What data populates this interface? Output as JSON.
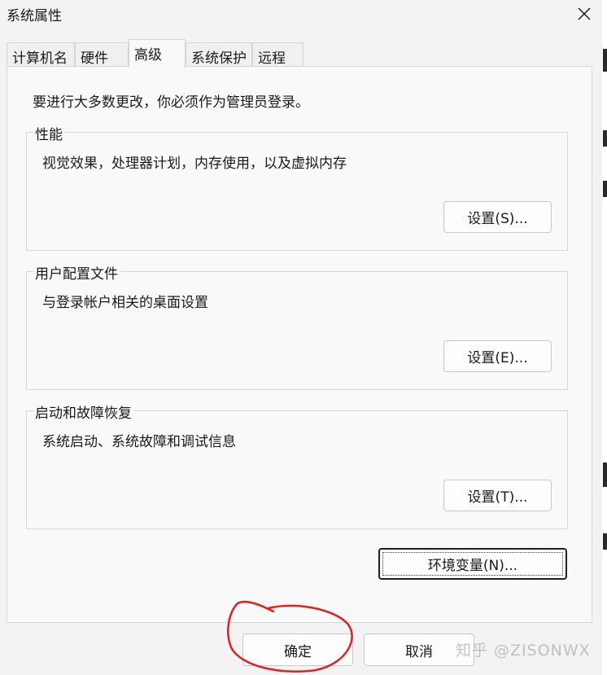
{
  "window": {
    "title": "系统属性"
  },
  "tabs": [
    {
      "label": "计算机名",
      "active": false
    },
    {
      "label": "硬件",
      "active": false
    },
    {
      "label": "高级",
      "active": true
    },
    {
      "label": "系统保护",
      "active": false
    },
    {
      "label": "远程",
      "active": false
    }
  ],
  "advanced": {
    "notice": "要进行大多数更改，你必须作为管理员登录。",
    "performance": {
      "title": "性能",
      "description": "视觉效果，处理器计划，内存使用，以及虚拟内存",
      "button": "设置(S)..."
    },
    "user_profiles": {
      "title": "用户配置文件",
      "description": "与登录帐户相关的桌面设置",
      "button": "设置(E)..."
    },
    "startup_recovery": {
      "title": "启动和故障恢复",
      "description": "系统启动、系统故障和调试信息",
      "button": "设置(T)..."
    },
    "env_button": "环境变量(N)..."
  },
  "footer": {
    "ok": "确定",
    "cancel": "取消"
  },
  "watermark": "知乎 @ZISONWX",
  "colors": {
    "background": "#f3f3f3",
    "panel": "#f9f9f9",
    "annotation": "#e02020"
  }
}
